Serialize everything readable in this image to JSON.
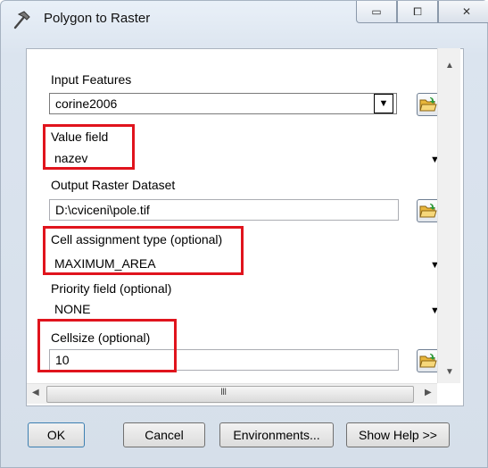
{
  "window": {
    "title": "Polygon to Raster",
    "controls": {
      "minimize": "▭",
      "maximize": "⧠",
      "close": "✕"
    }
  },
  "form": {
    "input_features": {
      "label": "Input Features",
      "value": "corine2006"
    },
    "value_field": {
      "label": "Value field",
      "value": "nazev"
    },
    "output_raster": {
      "label": "Output Raster Dataset",
      "value": "D:\\cviceni\\pole.tif"
    },
    "cell_assignment": {
      "label": "Cell assignment type (optional)",
      "value": "MAXIMUM_AREA"
    },
    "priority_field": {
      "label": "Priority field (optional)",
      "value": "NONE"
    },
    "cellsize": {
      "label": "Cellsize (optional)",
      "value": "10"
    }
  },
  "scrollbar": {
    "grip": "III"
  },
  "buttons": {
    "ok": "OK",
    "cancel": "Cancel",
    "environments": "Environments...",
    "show_help": "Show Help >>"
  },
  "icons": {
    "title": "hammer-icon",
    "browse": "folder-open-icon",
    "dropdown": "chevron-down-icon"
  },
  "colors": {
    "highlight": "#e0141d",
    "folder": "#e8b63a"
  }
}
